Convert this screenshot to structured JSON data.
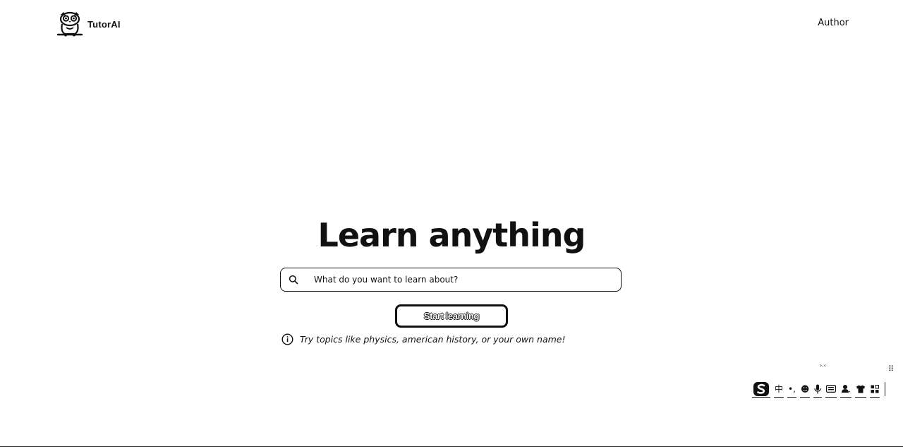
{
  "header": {
    "brand_name": "TutorAI",
    "logo_icon": "owl-mascot-icon",
    "author_link": "Author"
  },
  "hero": {
    "title": "Learn anything",
    "search": {
      "icon": "search-icon",
      "placeholder": "What do you want to learn about?",
      "value": ""
    },
    "start_button_label": "Start learning",
    "hint": {
      "icon": "info-icon",
      "text": "Try topics like physics, american history, or your own name!"
    }
  },
  "ime_toolbar": {
    "caret_text": "›.‹",
    "drag_handle": "⠿",
    "tools": [
      {
        "name": "sogou-logo-icon",
        "label": ""
      },
      {
        "name": "chinese-mode-toggle",
        "label": "中"
      },
      {
        "name": "punctuation-toggle",
        "label": "•,"
      },
      {
        "name": "emoji-icon",
        "label": "☻"
      },
      {
        "name": "microphone-icon",
        "label": "🎙"
      },
      {
        "name": "keyboard-icon",
        "label": "⌨"
      },
      {
        "name": "user-icon",
        "label": "⚇"
      },
      {
        "name": "skin-shirt-icon",
        "label": "👕"
      },
      {
        "name": "grid-menu-icon",
        "label": "▦"
      }
    ]
  },
  "colors": {
    "foreground": "#111111",
    "background": "#ffffff"
  }
}
